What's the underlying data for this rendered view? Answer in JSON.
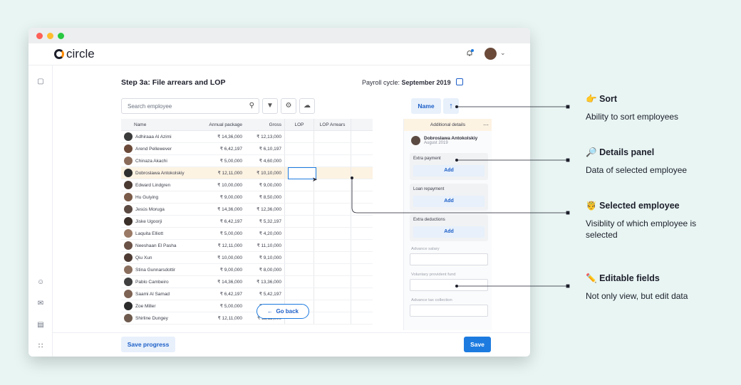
{
  "app": {
    "brand": "circle"
  },
  "page": {
    "title": "Step 3a: File arrears and LOP",
    "cycle_label": "Payroll cycle:",
    "cycle_value": "September 2019"
  },
  "toolbar": {
    "search_placeholder": "Search employee",
    "sort_label": "Name"
  },
  "table": {
    "headers": [
      "Name",
      "Annual package",
      "Gross",
      "LOP",
      "LOP Arrears"
    ],
    "rows": [
      {
        "name": "Adhiraaa Al Azimi",
        "pkg": "₹ 14,36,000",
        "gross": "₹ 12,13,000"
      },
      {
        "name": "Arend Pellewever",
        "pkg": "₹ 6,42,197",
        "gross": "₹ 6,10,197"
      },
      {
        "name": "Chinaza Akachi",
        "pkg": "₹ 5,00,000",
        "gross": "₹ 4,60,000"
      },
      {
        "name": "Dobroslawa Antokolskiy",
        "pkg": "₹ 12,11,000",
        "gross": "₹ 10,10,000"
      },
      {
        "name": "Edward Lindgren",
        "pkg": "₹ 10,00,000",
        "gross": "₹ 9,00,000"
      },
      {
        "name": "Hu Guiying",
        "pkg": "₹ 9,00,000",
        "gross": "₹ 8,50,000"
      },
      {
        "name": "Jesús Moruga",
        "pkg": "₹ 14,36,000",
        "gross": "₹ 12,36,000"
      },
      {
        "name": "Jiske Ugoorji",
        "pkg": "₹ 6,42,197",
        "gross": "₹ 5,32,197"
      },
      {
        "name": "Laquita Elliott",
        "pkg": "₹ 5,00,000",
        "gross": "₹ 4,20,000"
      },
      {
        "name": "Neeshaan El Pasha",
        "pkg": "₹ 12,11,000",
        "gross": "₹ 11,10,000"
      },
      {
        "name": "Qiu Xun",
        "pkg": "₹ 10,00,000",
        "gross": "₹ 9,10,000"
      },
      {
        "name": "Stina Gunnarsdottir",
        "pkg": "₹ 9,00,000",
        "gross": "₹ 8,00,000"
      },
      {
        "name": "Pablo Cambeiro",
        "pkg": "₹ 14,36,000",
        "gross": "₹ 13,36,000"
      },
      {
        "name": "Saami Al Samad",
        "pkg": "₹ 6,42,197",
        "gross": "₹ 5,42,197"
      },
      {
        "name": "Zoe Miller",
        "pkg": "₹ 5,00,000",
        "gross": "₹ 4,00,000"
      },
      {
        "name": "Shirline Dungey",
        "pkg": "₹ 12,11,000",
        "gross": "₹ 11,11,000"
      }
    ],
    "selected_index": 3
  },
  "panel": {
    "title": "Additional details",
    "employee_name": "Dobroslawa Antokolskiy",
    "employee_date": "August 2019",
    "sections": [
      {
        "label": "Extra payment",
        "button": "Add"
      },
      {
        "label": "Loan repayment",
        "button": "Add"
      },
      {
        "label": "Extra deductions",
        "button": "Add"
      }
    ],
    "fields": [
      "Advance salary",
      "Voluntary provident fund",
      "Advance tax collection"
    ]
  },
  "buttons": {
    "go_back": "Go back",
    "save_progress": "Save progress",
    "save": "Save"
  },
  "annotations": [
    {
      "emoji": "👉",
      "title": "Sort",
      "desc": "Ability to sort employees"
    },
    {
      "emoji": "🔎",
      "title": "Details panel",
      "desc": "Data of selected employee"
    },
    {
      "emoji": "🤴",
      "title": "Selected employee",
      "desc": "Visiblity of which employee is selected"
    },
    {
      "emoji": "✏️",
      "title": "Editable fields",
      "desc": "Not only view, but edit data"
    }
  ],
  "colors": {
    "background": "#e8f5f3",
    "accent": "#1d7be0",
    "selected_row": "#fdf3e3"
  }
}
